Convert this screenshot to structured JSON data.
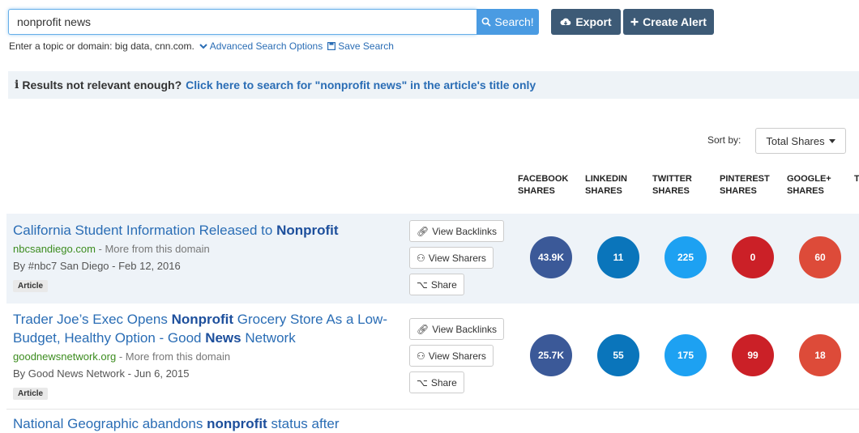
{
  "search": {
    "value": "nonprofit news",
    "button_label": "Search!",
    "hint": "Enter a topic or domain: big data, cnn.com.",
    "advanced_label": "Advanced Search Options",
    "save_label": "Save Search"
  },
  "toolbar": {
    "export_label": "Export",
    "create_alert_label": "Create Alert"
  },
  "notice": {
    "prefix": "Results not relevant enough?",
    "link": "Click here to search for \"nonprofit news\" in the article's title only"
  },
  "sort": {
    "label": "Sort by:",
    "selected": "Total Shares"
  },
  "columns": [
    {
      "line1": "FACEBOOK",
      "line2": "SHARES"
    },
    {
      "line1": "LINKEDIN",
      "line2": "SHARES"
    },
    {
      "line1": "TWITTER",
      "line2": "SHARES"
    },
    {
      "line1": "PINTEREST",
      "line2": "SHARES"
    },
    {
      "line1": "GOOGLE+",
      "line2": "SHARES"
    },
    {
      "line1": "T",
      "line2": ""
    }
  ],
  "actions": {
    "backlinks": "View Backlinks",
    "sharers": "View Sharers",
    "share": "Share"
  },
  "colors": {
    "facebook": "#3b5998",
    "linkedin": "#0a75bb",
    "twitter": "#1da1f2",
    "pinterest": "#cb2027",
    "googleplus": "#dd4b39"
  },
  "results": [
    {
      "title_pre": "California Student Information Released to ",
      "title_bold": "Nonprofit",
      "domain": "nbcsandiego.com",
      "more": " - More from this domain",
      "byline": "By #nbc7 San Diego - Feb 12, 2016",
      "type": "Article",
      "shares": {
        "facebook": "43.9K",
        "linkedin": "11",
        "twitter": "225",
        "pinterest": "0",
        "googleplus": "60"
      }
    },
    {
      "title_l1_pre": "Trader Joe’s Exec Opens ",
      "title_l1_bold": "Nonprofit",
      "title_l1_post": " Grocery Store As a Low-",
      "title_l2_pre": "Budget, Healthy Option - Good ",
      "title_l2_bold": "News",
      "title_l2_post": " Network",
      "domain": "goodnewsnetwork.org",
      "more": " - More from this domain",
      "byline": "By Good News Network - Jun 6, 2015",
      "type": "Article",
      "shares": {
        "facebook": "25.7K",
        "linkedin": "55",
        "twitter": "175",
        "pinterest": "99",
        "googleplus": "18"
      }
    },
    {
      "title_pre": "National Geographic abandons ",
      "title_bold": "nonprofit",
      "title_post": " status after"
    }
  ]
}
